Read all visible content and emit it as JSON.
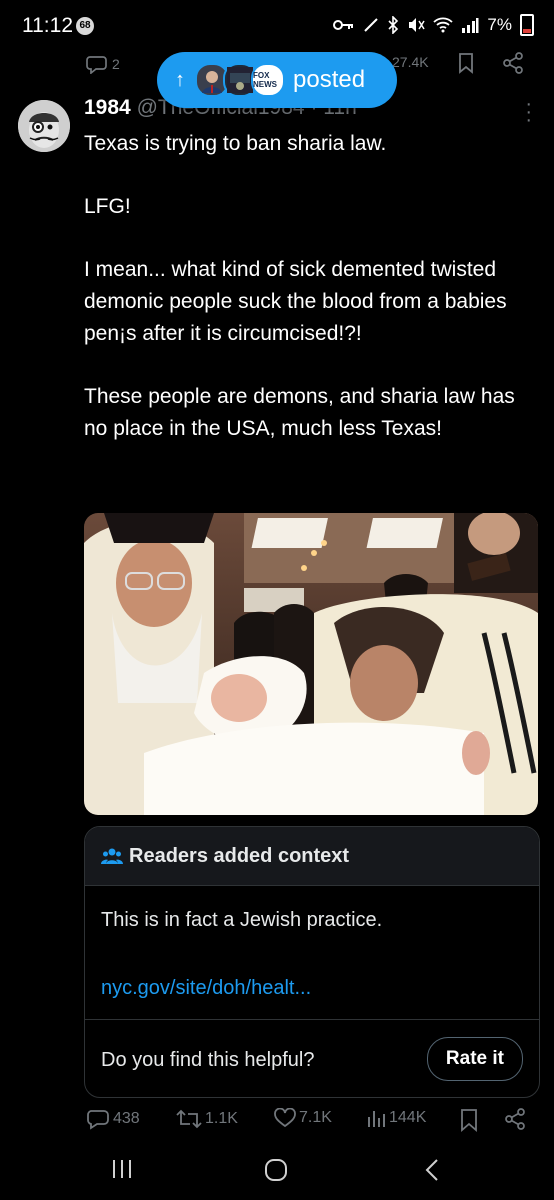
{
  "status_bar": {
    "time": "11:12",
    "notification_badge": "68",
    "battery_percent": "7%"
  },
  "previous_post": {
    "reply_count": "2",
    "view_count": "27.4K"
  },
  "posted_pill": {
    "label": "posted",
    "avatar_badge": "FOX NEWS"
  },
  "tweet": {
    "name": "1984",
    "handle": "@TheOfficial1984",
    "time": "· 11h",
    "paragraphs": [
      "Texas is trying to ban sharia law.",
      "LFG!",
      "I mean... what kind of sick demented twisted demonic people suck the blood from a babies pen¡s after it is circumcised!?!",
      "These people are demons, and sharia law has no place in the USA, much less Texas!"
    ]
  },
  "community_note": {
    "title": "Readers added context",
    "body": "This is in fact a Jewish practice.",
    "link": "nyc.gov/site/doh/healt...",
    "question": "Do you find this helpful?",
    "rate_label": "Rate it"
  },
  "actions": {
    "replies": "438",
    "reposts": "1.1K",
    "likes": "7.1K",
    "views": "144K"
  },
  "colors": {
    "background": "#000000",
    "accent": "#1d9bf0",
    "muted": "#71767b",
    "border": "#2f3336"
  }
}
